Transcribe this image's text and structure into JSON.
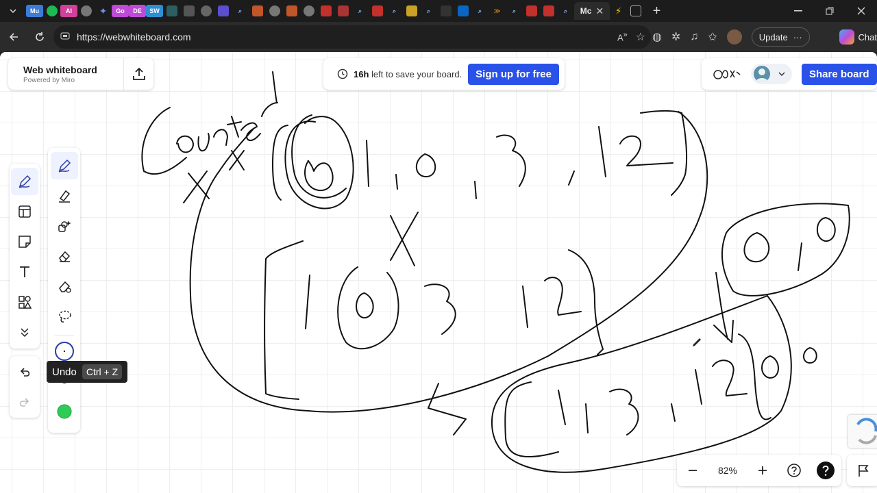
{
  "browser": {
    "tabs": [
      {
        "icon": "tab-menu-icon"
      },
      {
        "label": "Mu",
        "color": "#3d7bd9"
      },
      {
        "icon": "spotify-icon",
        "color": "#1db954"
      },
      {
        "label": "AI",
        "color": "#d1409a"
      },
      {
        "icon": "chatgpt-icon",
        "color": "#888888"
      },
      {
        "icon": "gemini-icon",
        "color": "#6f8ff0"
      },
      {
        "label": "Go",
        "color": "#c04ad8"
      },
      {
        "label": "DE",
        "color": "#c04ad8"
      },
      {
        "label": "SW",
        "color": "#2f8fd4"
      }
    ],
    "active_tab_label": "Mc",
    "url": "https://webwhiteboard.com",
    "update_label": "Update",
    "copilot_label": "Chat"
  },
  "app": {
    "title": "Web whiteboard",
    "subtitle": "Powered by Miro",
    "save_notice": {
      "emphasis": "16h",
      "rest": " left to save your board."
    },
    "signup_label": "Sign up for free",
    "share_label": "Share board"
  },
  "toolbar": {
    "tools": [
      "pen-icon",
      "frame-icon",
      "sticky-note-icon",
      "text-icon",
      "shapes-icon",
      "more-chevron-icon"
    ]
  },
  "subtools": [
    "pen-tool-icon",
    "highlighter-icon",
    "smart-draw-icon",
    "eraser-icon",
    "object-eraser-icon",
    "lasso-icon"
  ],
  "colors": {
    "accent": "#2a52e8",
    "pen_blue": "#2d3aa8",
    "pen_red": "#e34b4b",
    "pen_green": "#2ecc55"
  },
  "tooltip": {
    "label": "Undo",
    "shortcut": "Ctrl + Z"
  },
  "zoom": {
    "level": "82%"
  }
}
